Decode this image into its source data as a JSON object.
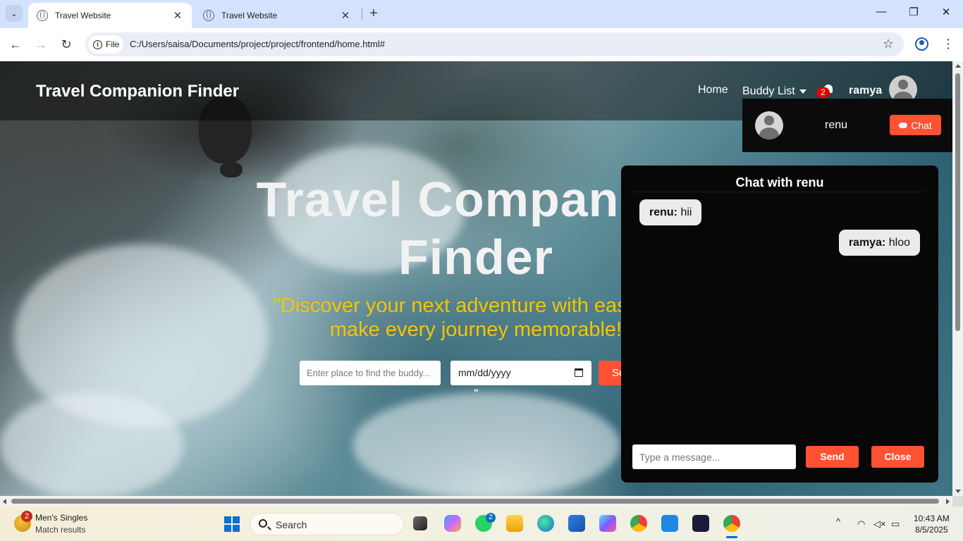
{
  "browser": {
    "tabs": [
      {
        "title": "Travel Website",
        "active": true
      },
      {
        "title": "Travel Website",
        "active": false
      }
    ],
    "new_tab_symbol": "+",
    "file_label": "File",
    "url": "C:/Users/saisa/Documents/project/project/frontend/home.html#"
  },
  "site": {
    "brand": "Travel Companion Finder",
    "nav": {
      "home": "Home",
      "buddy_list": "Buddy List",
      "notification_count": "2",
      "username": "ramya"
    },
    "dropdown": {
      "buddy_name": "renu",
      "chat_label": "Chat"
    },
    "hero": {
      "title": "Travel Companion Finder",
      "quote": "\"Discover your next adventure with ease and make every journey memorable!",
      "stray_quote": "\""
    },
    "search": {
      "place_placeholder": "Enter place to find the buddy...",
      "date_value": "mm/dd/yyyy",
      "search_label": "Search"
    }
  },
  "chat": {
    "title": "Chat with renu",
    "messages": [
      {
        "sender": "renu:",
        "text": " hii",
        "direction": "incoming"
      },
      {
        "sender": "ramya:",
        "text": " hloo",
        "direction": "outgoing"
      }
    ],
    "input_placeholder": "Type a message...",
    "send_label": "Send",
    "close_label": "Close"
  },
  "taskbar": {
    "widget_badge": "2",
    "widget_title": "Men's Singles",
    "widget_subtitle": "Match results",
    "search_label": "Search",
    "whatsapp_badge": "2",
    "time": "10:43 AM",
    "date": "8/5/2025"
  },
  "colors": {
    "accent": "#ff5233",
    "quote": "#f6c400",
    "badge": "#e00000",
    "chat_bg": "#070707"
  }
}
